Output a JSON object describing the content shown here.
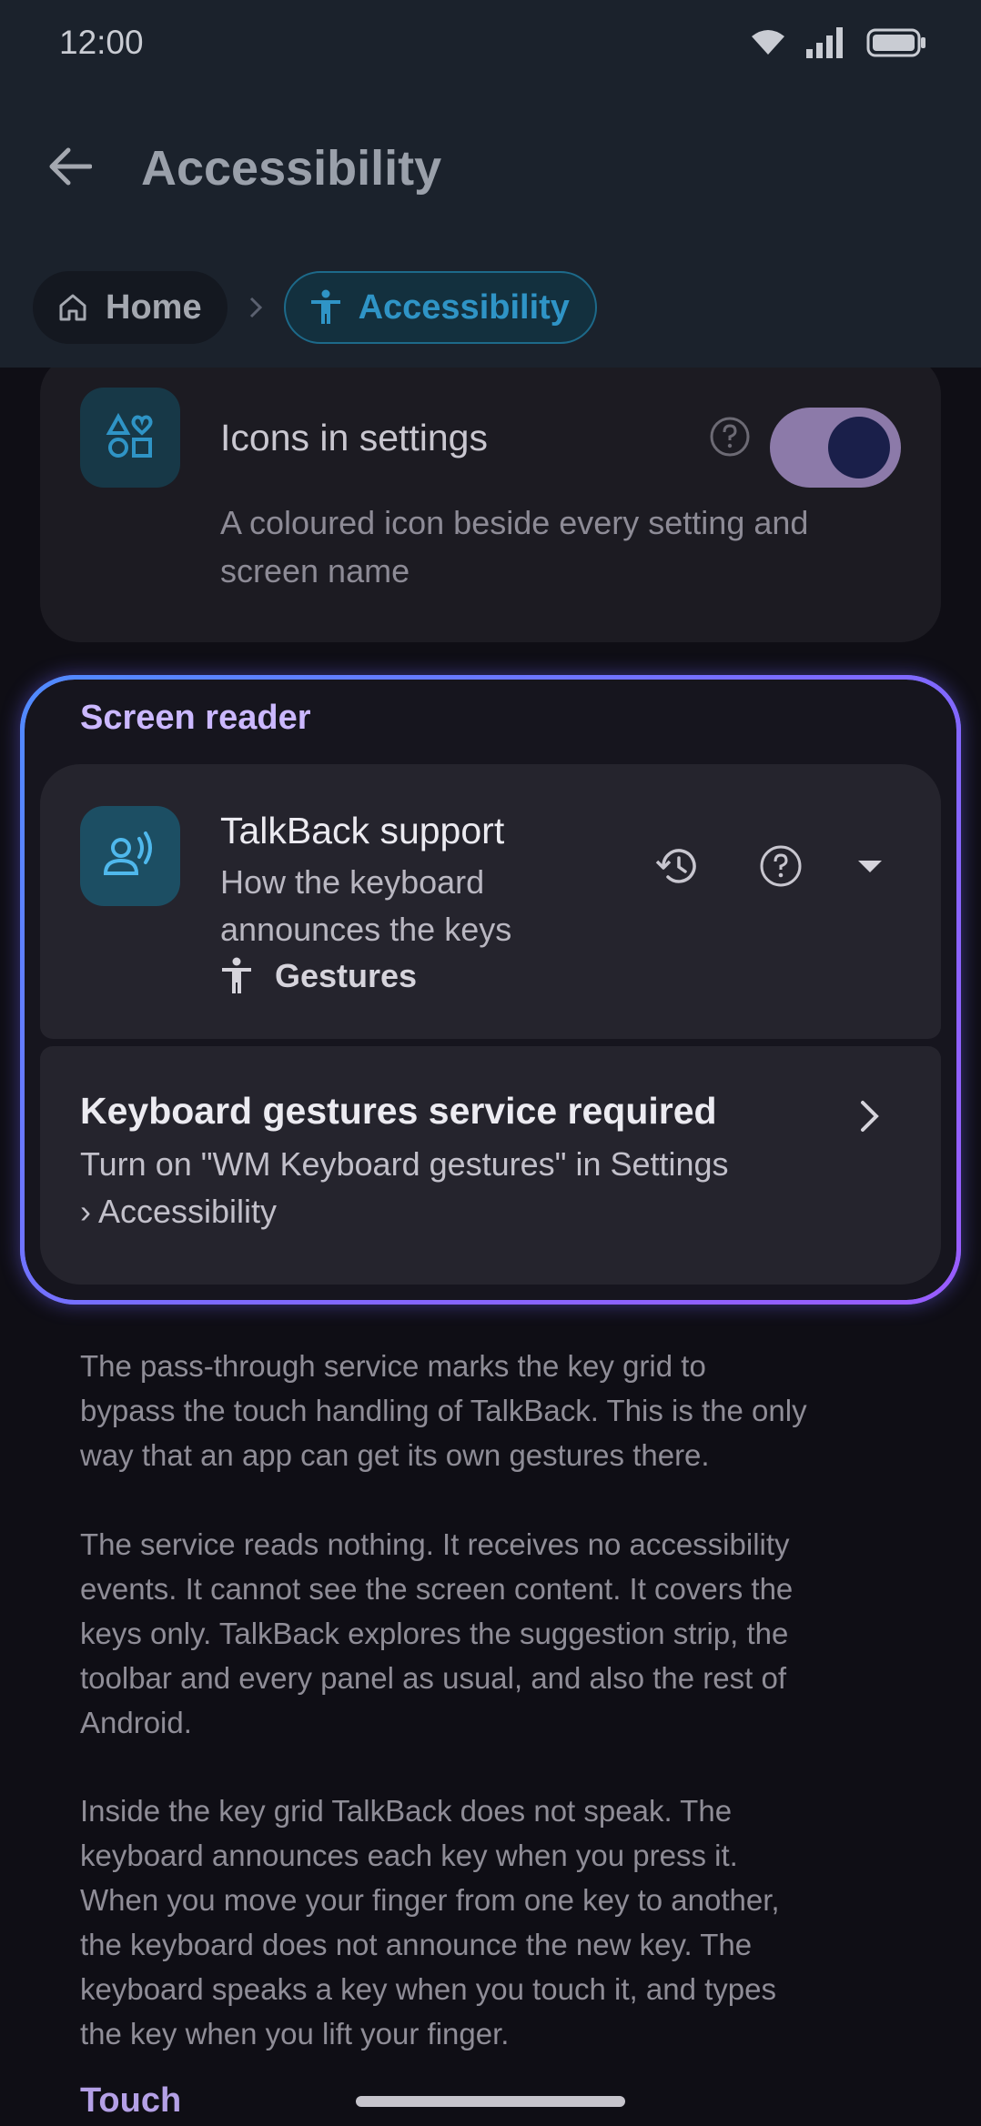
{
  "status_bar": {
    "time": "12:00"
  },
  "header": {
    "title": "Accessibility"
  },
  "breadcrumb": {
    "home": "Home",
    "current": "Accessibility"
  },
  "icons_setting": {
    "title": "Icons in settings",
    "description_line1": "A coloured icon beside every setting and",
    "description_line2": "screen name",
    "enabled": true
  },
  "screen_reader": {
    "section_label": "Screen reader",
    "talkback": {
      "title": "TalkBack support",
      "subtitle_line1": "How the keyboard",
      "subtitle_line2": "announces the keys",
      "chip_label": "Gestures"
    },
    "gestures_service": {
      "title": "Keyboard gestures service required",
      "subtitle_line1": "Turn on \"WM Keyboard gestures\" in Settings",
      "subtitle_line2": "› Accessibility"
    }
  },
  "body": {
    "para1": [
      "The pass-through service marks the key grid to",
      "bypass the touch handling of TalkBack. This is the only",
      "way that an app can get its own gestures there."
    ],
    "para2": [
      "The service reads nothing. It receives no accessibility",
      "events. It cannot see the screen content. It covers the",
      "keys only. TalkBack explores the suggestion strip, the",
      "toolbar and every panel as usual, and also the rest of",
      "Android."
    ],
    "para3": [
      "Inside the key grid TalkBack does not speak. The",
      "keyboard announces each key when you press it.",
      "When you move your finger from one key to another,",
      "the keyboard does not announce the new key. The",
      "keyboard speaks a key when you touch it, and types",
      "the key when you lift your finger."
    ],
    "next_heading": "Touch"
  },
  "colors": {
    "accent_blue": "#2f94c6",
    "highlight_border_start": "#4f8bff",
    "highlight_border_end": "#9a5cff",
    "section_label": "#cbb8ff",
    "toggle_track": "#8c7aa9"
  }
}
